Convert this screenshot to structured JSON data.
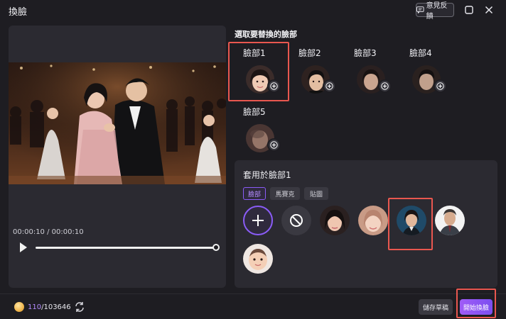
{
  "window": {
    "title": "換臉",
    "feedback_label": "意見反饋"
  },
  "preview": {
    "timecode": "00:00:10 / 00:00:10",
    "progress": 1.0
  },
  "faces": {
    "section_title": "選取要替換的臉部",
    "items": [
      {
        "label": "臉部1",
        "selected": true
      },
      {
        "label": "臉部2",
        "selected": false
      },
      {
        "label": "臉部3",
        "selected": false
      },
      {
        "label": "臉部4",
        "selected": false
      },
      {
        "label": "臉部5",
        "selected": false
      }
    ]
  },
  "apply": {
    "title": "套用於臉部1",
    "tabs": [
      {
        "label": "臉部",
        "active": true
      },
      {
        "label": "馬賽克",
        "active": false
      },
      {
        "label": "貼圖",
        "active": false
      }
    ],
    "options": [
      {
        "icon": "plus-icon"
      },
      {
        "icon": "prohibited-icon"
      },
      {
        "icon": "face-option-woman-dark-hair"
      },
      {
        "icon": "face-option-woman-light"
      },
      {
        "icon": "face-option-woman-suit",
        "selected": true
      },
      {
        "icon": "face-option-man-suit"
      },
      {
        "icon": "face-option-baby"
      }
    ]
  },
  "footer": {
    "credits_used": "110",
    "credits_total": "/103646",
    "save_draft_label": "儲存草稿",
    "start_label": "開始換臉"
  },
  "colors": {
    "accent": "#8a5cf6",
    "highlight": "#e9574f",
    "background": "#1e1d22",
    "panel": "#2b2a31"
  }
}
